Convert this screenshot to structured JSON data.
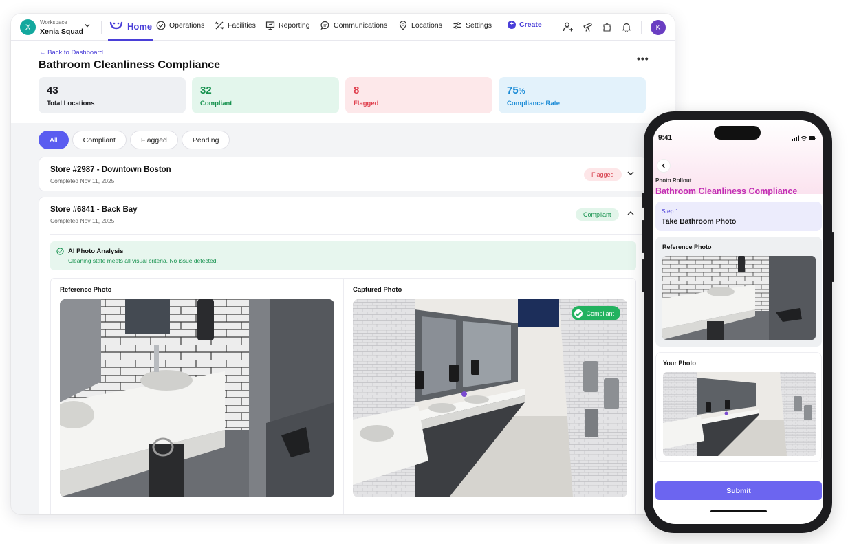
{
  "workspace": {
    "avatar_letter": "X",
    "label": "Workspace",
    "name": "Xenia Squad"
  },
  "nav": {
    "home": "Home",
    "items": [
      "Operations",
      "Facilities",
      "Reporting",
      "Communications",
      "Locations",
      "Settings"
    ],
    "create": "Create",
    "user_initial": "K"
  },
  "page": {
    "back": "Back to Dashboard",
    "title": "Bathroom Cleanliness Compliance",
    "more": "•••"
  },
  "stats": [
    {
      "value": "43",
      "unit": "",
      "label": "Total Locations",
      "bg": "#eef0f3",
      "color": "#1a1a1f"
    },
    {
      "value": "32",
      "unit": "",
      "label": "Compliant",
      "bg": "#e3f6ec",
      "color": "#17924f"
    },
    {
      "value": "8",
      "unit": "",
      "label": "Flagged",
      "bg": "#fde8ea",
      "color": "#e0414f"
    },
    {
      "value": "75",
      "unit": "%",
      "label": "Compliance Rate",
      "bg": "#e3f2fb",
      "color": "#1a8bd6"
    }
  ],
  "filters": [
    "All",
    "Compliant",
    "Flagged",
    "Pending"
  ],
  "stores": [
    {
      "name": "Store #2987 - Downtown Boston",
      "completed": "Completed Nov 11, 2025",
      "status": "Flagged"
    },
    {
      "name": "Store #6841 - Back Bay",
      "completed": "Completed Nov 11, 2025",
      "status": "Compliant"
    }
  ],
  "analysis": {
    "title": "AI Photo Analysis",
    "description": "Cleaning state meets all visual criteria. No issue detected."
  },
  "photos": {
    "reference_label": "Reference Photo",
    "captured_label": "Captured Photo",
    "captured_badge": "Compliant"
  },
  "phone": {
    "time": "9:41",
    "kicker": "Photo Rollout",
    "title": "Bathroom Cleanliness Compliance",
    "step_label": "Step 1",
    "step_title": "Take Bathroom Photo",
    "reference_label": "Reference Photo",
    "your_label": "Your Photo",
    "submit": "Submit"
  },
  "colors": {
    "accent": "#4a3fd8",
    "compliant": "#22b25f",
    "flagged": "#e0414f"
  }
}
